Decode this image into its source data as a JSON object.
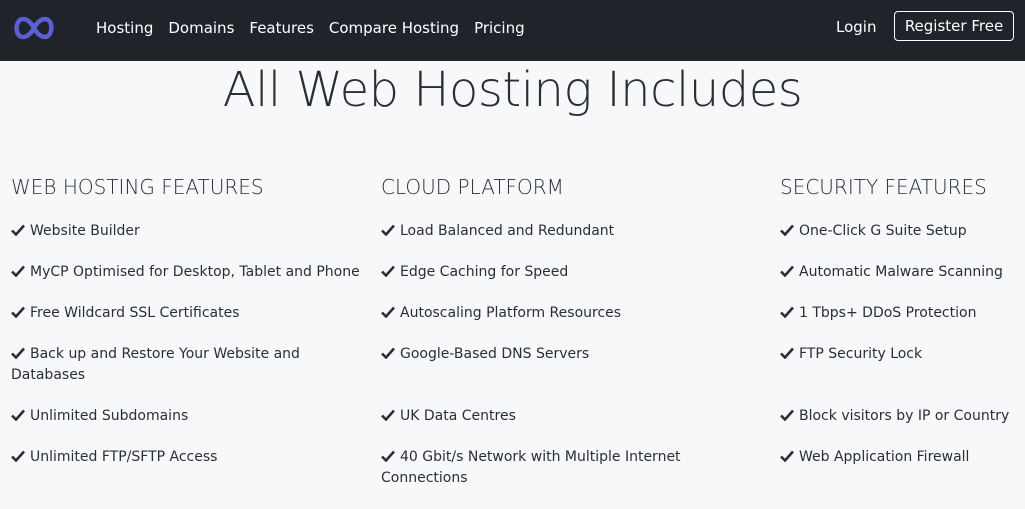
{
  "nav": {
    "logo": "infinity-logo-icon",
    "links": [
      "Hosting",
      "Domains",
      "Features",
      "Compare Hosting",
      "Pricing"
    ],
    "login": "Login",
    "register": "Register Free"
  },
  "hero": {
    "title": "All Web Hosting Includes"
  },
  "columns": [
    {
      "title": "WEB HOSTING FEATURES",
      "items": [
        "Website Builder",
        "MyCP Optimised for Desktop, Tablet and Phone",
        "Free Wildcard SSL Certificates",
        "Back up and Restore Your Website and Databases",
        "Unlimited Subdomains",
        "Unlimited FTP/SFTP Access"
      ]
    },
    {
      "title": "CLOUD PLATFORM",
      "items": [
        "Load Balanced and Redundant",
        "Edge Caching for Speed",
        "Autoscaling Platform Resources",
        "Google-Based DNS Servers",
        "UK Data Centres",
        "40 Gbit/s Network with Multiple Internet Connections"
      ]
    },
    {
      "title": "SECURITY FEATURES",
      "items": [
        "One-Click G Suite Setup",
        "Automatic Malware Scanning",
        "1 Tbps+ DDoS Protection",
        "FTP Security Lock",
        "Block visitors by IP or Country",
        "Web Application Firewall"
      ]
    }
  ],
  "colors": {
    "navbar": "#20242a",
    "logo": "#5b5fd6",
    "background": "#f6f8fa",
    "text": "#2b2f33"
  }
}
